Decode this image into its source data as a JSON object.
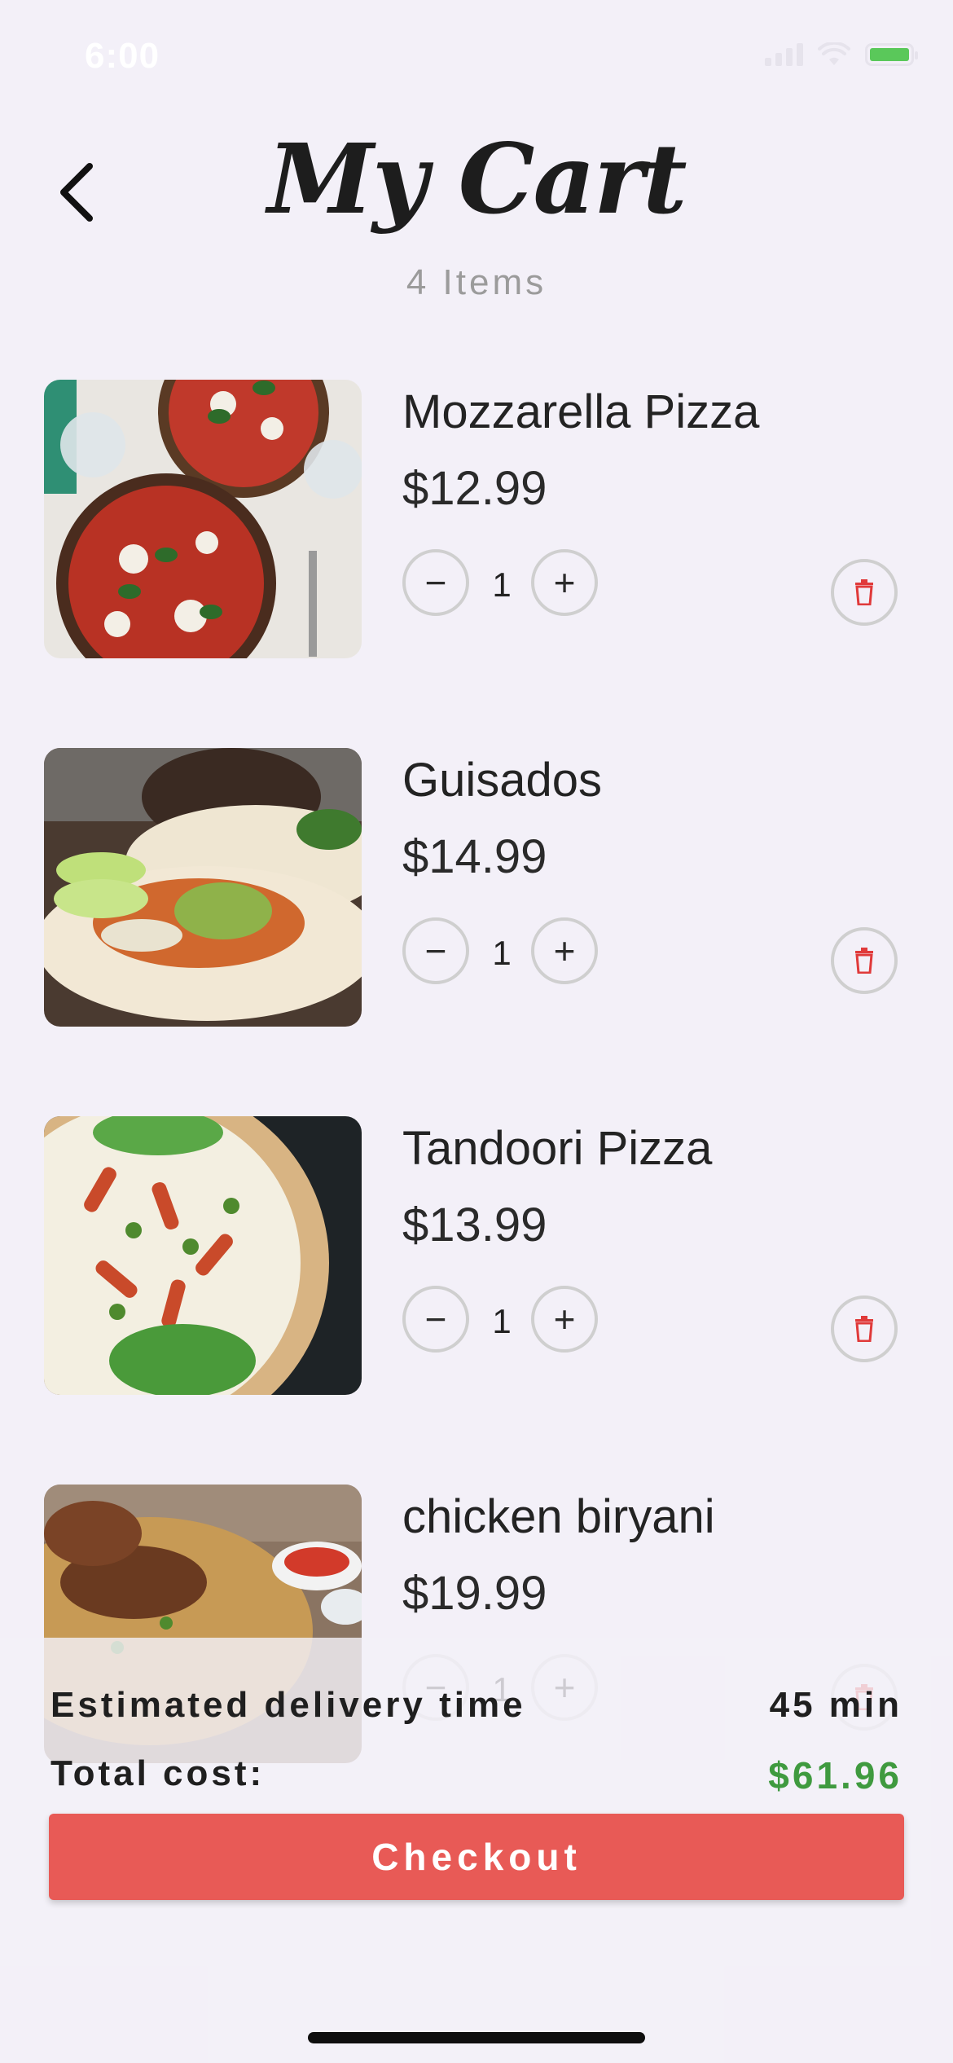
{
  "status_bar": {
    "time": "6:00"
  },
  "header": {
    "title": "My Cart",
    "subtitle": "4 Items"
  },
  "items": [
    {
      "name": "Mozzarella Pizza",
      "price": "$12.99",
      "quantity": "1",
      "minus": "−",
      "plus": "+"
    },
    {
      "name": "Guisados",
      "price": "$14.99",
      "quantity": "1",
      "minus": "−",
      "plus": "+"
    },
    {
      "name": "Tandoori Pizza",
      "price": "$13.99",
      "quantity": "1",
      "minus": "−",
      "plus": "+"
    },
    {
      "name": "chicken biryani",
      "price": "$19.99",
      "quantity": "1",
      "minus": "−",
      "plus": "+"
    }
  ],
  "summary": {
    "delivery_label": "Estimated delivery time",
    "delivery_value": "45 min",
    "total_label": "Total cost:",
    "total_value": "$61.96"
  },
  "checkout_label": "Checkout",
  "icons": {
    "back": "chevron-left-icon",
    "delete": "trash-icon",
    "signal": "signal-icon",
    "wifi": "wifi-icon",
    "battery": "battery-icon"
  },
  "colors": {
    "background": "#f3f0f8",
    "checkout": "#e85a56",
    "total": "#3f9a3f",
    "delete": "#e03a3a"
  }
}
